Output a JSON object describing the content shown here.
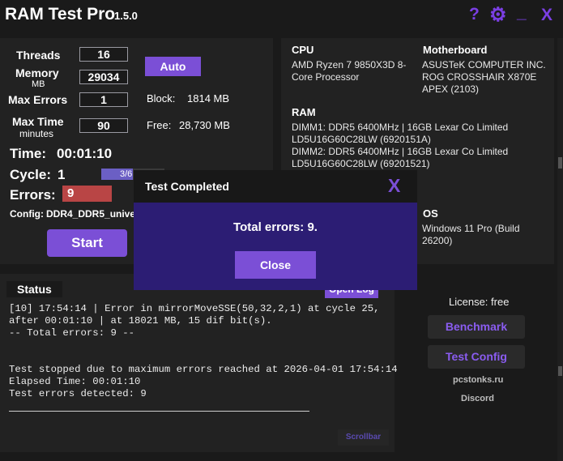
{
  "app": {
    "title": "RAM Test Pro",
    "version": "1.5.0"
  },
  "titlebar": {
    "help_glyph": "?",
    "settings_glyph": "⚙",
    "minimize_glyph": "_",
    "close_glyph": "X"
  },
  "settings": {
    "threads_label": "Threads",
    "threads_value": "16",
    "memory_label": "Memory",
    "memory_unit": "MB",
    "memory_value": "29034",
    "max_errors_label": "Max Errors",
    "max_errors_value": "1",
    "max_time_label": "Max Time",
    "max_time_unit": "minutes",
    "max_time_value": "90",
    "auto_label": "Auto",
    "block_label": "Block:",
    "block_value": "1814 MB",
    "free_label": "Free:",
    "free_value": "28,730 MB"
  },
  "status_info": {
    "time_label": "Time:",
    "time_value": "00:01:10",
    "cycle_label": "Cycle:",
    "cycle_value": "1",
    "cycle_progress_text": "3/6",
    "errors_label": "Errors:",
    "errors_value": "9",
    "config_label": "Config:",
    "config_value": "DDR4_DDR5_unive",
    "start_label": "Start"
  },
  "system": {
    "cpu_head": "CPU",
    "cpu_value": "AMD Ryzen 7 9850X3D 8-\nCore Processor",
    "mb_head": "Motherboard",
    "mb_value": "ASUSTeK COMPUTER INC.\nROG CROSSHAIR X870E\nAPEX (2103)",
    "ram_head": "RAM",
    "ram_value": "DIMM1: DDR5 6400MHz | 16GB Lexar Co Limited\nLD5U16G60C28LW (6920151A)\nDIMM2: DDR5 6400MHz | 16GB Lexar Co Limited\nLD5U16G60C28LW (69201521)",
    "os_head": "OS",
    "os_value": "Windows 11 Pro (Build\n26200)"
  },
  "status_panel": {
    "title": "Status",
    "open_log_label": "Open Log",
    "log_text": "[10] 17:54:14 | Error in mirrorMoveSSE(50,32,2,1) at cycle 25,\nafter 00:01:10 | at 18021 MB, 15 dif bit(s).\n-- Total errors: 9 --\n\n\nTest stopped due to maximum errors reached at 2026-04-01 17:54:14\nElapsed Time: 00:01:10\nTest errors detected: 9",
    "scrollbar_label": "Scrollbar"
  },
  "sidebar": {
    "license_text": "License: free",
    "benchmark_label": "Benchmark",
    "test_config_label": "Test Config",
    "website_text": "pcstonks.ru",
    "discord_text": "Discord"
  },
  "modal": {
    "title": "Test Completed",
    "close_glyph": "X",
    "message": "Total errors: 9.",
    "close_label": "Close"
  },
  "colors": {
    "accent": "#7b4fd6",
    "error_red": "#b94545",
    "modal_bg": "#2c1d74"
  }
}
